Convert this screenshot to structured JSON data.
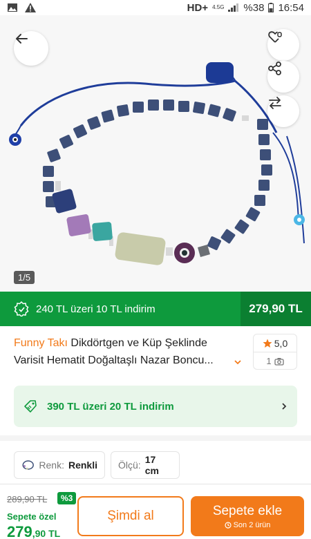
{
  "status_bar": {
    "network": "HD+",
    "network_small": "4.5G",
    "battery": "%38",
    "time": "16:54"
  },
  "gallery": {
    "counter": "1/5"
  },
  "promo_bar": {
    "text": "240 TL üzeri 10 TL indirim",
    "price": "279,90 TL"
  },
  "product": {
    "brand": "Funny Takı",
    "title_line1_rest": "Dikdörtgen ve Küp Şeklinde",
    "title_line2": "Varisit Hematit Doğaltaşlı Nazar Boncu..."
  },
  "rating": {
    "score": "5,0",
    "photo_count": "1"
  },
  "coupon": {
    "text": "390 TL üzeri 20 TL indirim"
  },
  "attributes": {
    "color_key": "Renk:",
    "color_value": "Renkli",
    "size_key": "Ölçü:",
    "size_value": "17 cm"
  },
  "bottom_bar": {
    "old_price": "289,90 TL",
    "discount_badge": "%3",
    "special_label": "Sepete özel",
    "special_price_main": "279",
    "special_price_rest": ",90 TL",
    "buy_now": "Şimdi al",
    "add_to_cart": "Sepete ekle",
    "stock_note": "Son 2 ürün"
  },
  "colors": {
    "brand_orange": "#f27a1a",
    "promo_green": "#0e9a3d",
    "promo_dark_green": "#0b7f31"
  }
}
